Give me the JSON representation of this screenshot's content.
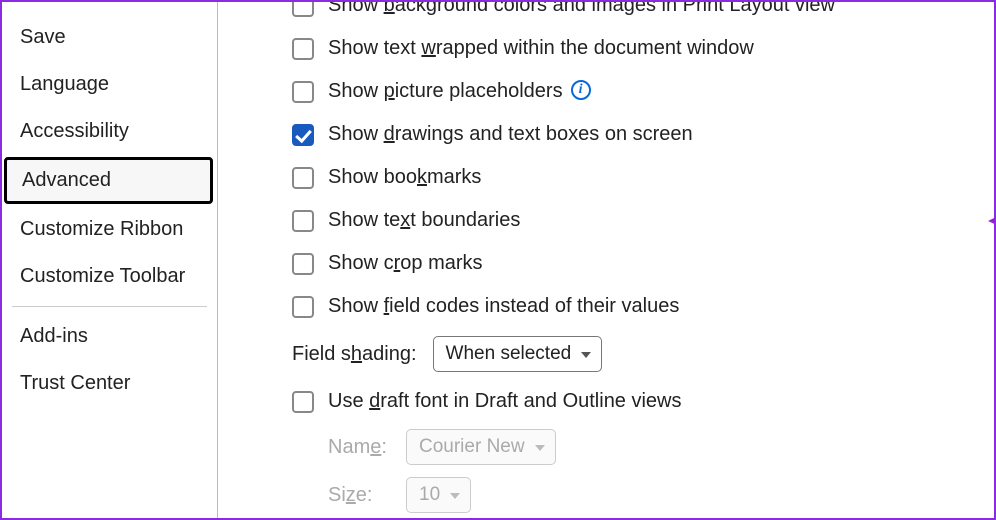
{
  "sidebar": {
    "items": [
      {
        "label": "Save"
      },
      {
        "label": "Language"
      },
      {
        "label": "Accessibility"
      },
      {
        "label": "Advanced"
      },
      {
        "label": "Customize Ribbon"
      },
      {
        "label": "Customize Toolbar"
      }
    ],
    "items2": [
      {
        "label": "Add-ins"
      },
      {
        "label": "Trust Center"
      }
    ],
    "selected_index": 3
  },
  "options": {
    "bg_colors_pre": "Show ",
    "bg_colors_u": "b",
    "bg_colors_post": "ackground colors and images in Print Layout view",
    "wrapped_pre": "Show text ",
    "wrapped_u": "w",
    "wrapped_post": "rapped within the document window",
    "placeholders_pre": "Show ",
    "placeholders_u": "p",
    "placeholders_post": "icture placeholders",
    "drawings_pre": "Show ",
    "drawings_u": "d",
    "drawings_post": "rawings and text boxes on screen",
    "bookmarks_pre": "Show boo",
    "bookmarks_u": "k",
    "bookmarks_post": "marks",
    "boundaries_pre": "Show te",
    "boundaries_u": "x",
    "boundaries_post": "t boundaries",
    "crop_pre": "Show c",
    "crop_u": "r",
    "crop_post": "op marks",
    "fieldcodes_pre": "Show ",
    "fieldcodes_u": "f",
    "fieldcodes_post": "ield codes instead of their values",
    "shading_pre": "Field s",
    "shading_u": "h",
    "shading_post": "ading:",
    "shading_value": "When selected",
    "draft_pre": "Use ",
    "draft_u": "d",
    "draft_post": "raft font in Draft and Outline views",
    "name_pre": "Nam",
    "name_u": "e",
    "name_post": ":",
    "name_value": "Courier New",
    "size_pre": "Si",
    "size_u": "z",
    "size_post": "e:",
    "size_value": "10"
  }
}
